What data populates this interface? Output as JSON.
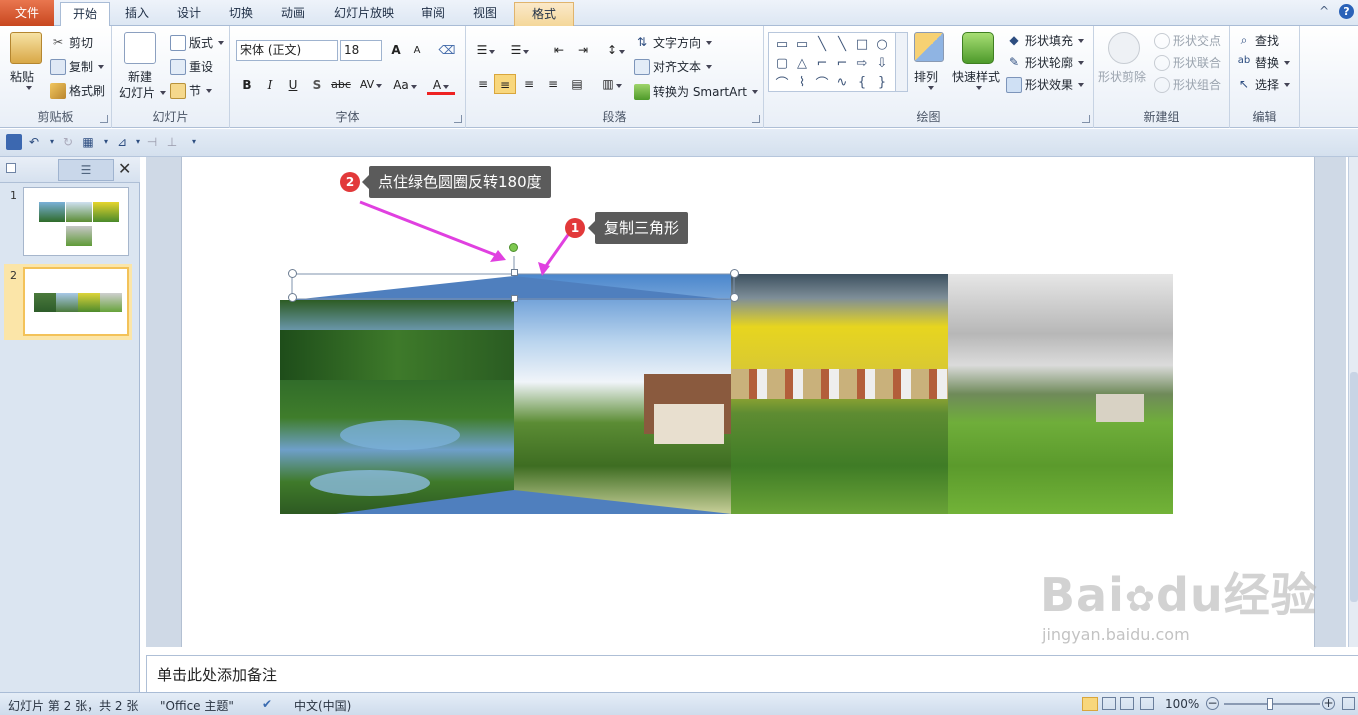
{
  "tabs": [
    {
      "label": "文件",
      "kind": "file"
    },
    {
      "label": "开始",
      "kind": "active"
    },
    {
      "label": "插入"
    },
    {
      "label": "设计"
    },
    {
      "label": "切换"
    },
    {
      "label": "动画"
    },
    {
      "label": "幻灯片放映"
    },
    {
      "label": "审阅"
    },
    {
      "label": "视图"
    },
    {
      "label": "格式",
      "kind": "format"
    }
  ],
  "help": {
    "caret": "^",
    "q": "?"
  },
  "clipboard": {
    "paste": "粘贴",
    "cut": "剪切",
    "copy": "复制",
    "format_painter": "格式刷",
    "label": "剪贴板"
  },
  "slides": {
    "new_slide_l1": "新建",
    "new_slide_l2": "幻灯片",
    "layout": "版式",
    "reset": "重设",
    "section": "节",
    "label": "幻灯片"
  },
  "font": {
    "name": "宋体 (正文)",
    "size": "18",
    "grow": "A",
    "shrink": "A",
    "bold": "B",
    "italic": "I",
    "underline": "U",
    "shadow": "S",
    "strike": "abc",
    "spacing": "AV",
    "case": "Aa",
    "color": "A",
    "label": "字体"
  },
  "paragraph": {
    "text_direction": "文字方向",
    "align_text": "对齐文本",
    "smartart": "转换为 SmartArt",
    "label": "段落"
  },
  "drawing": {
    "arrange": "排列",
    "quick_styles": "快速样式",
    "shape_fill": "形状填充",
    "shape_outline": "形状轮廓",
    "shape_effects": "形状效果",
    "label": "绘图"
  },
  "newgroup": {
    "shape_cut": "形状剪除",
    "shape_intersect": "形状交点",
    "shape_union": "形状联合",
    "shape_combine": "形状组合",
    "label": "新建组"
  },
  "editing": {
    "find": "查找",
    "replace": "替换",
    "select": "选择",
    "label": "编辑"
  },
  "thumbnails": [
    {
      "num": "1"
    },
    {
      "num": "2"
    }
  ],
  "annotations": {
    "a1": {
      "num": "1",
      "text": "复制三角形"
    },
    "a2": {
      "num": "2",
      "text": "点住绿色圆圈反转180度"
    }
  },
  "notes": {
    "placeholder": "单击此处添加备注"
  },
  "status": {
    "slide_info": "幻灯片 第 2 张，共 2 张",
    "theme": "\"Office 主题\"",
    "language": "中文(中国)",
    "zoom": "100%"
  },
  "watermark": {
    "brand": "Bai",
    "brand2": "du",
    "brand_cn": "经验",
    "url": "jingyan.baidu.com"
  },
  "colors": {
    "accent_shape": "#4f7fbe",
    "handle_green": "#7ec850",
    "callout_bg": "#5b5b5b",
    "badge": "#e2393a",
    "arrow": "#e040e0"
  }
}
